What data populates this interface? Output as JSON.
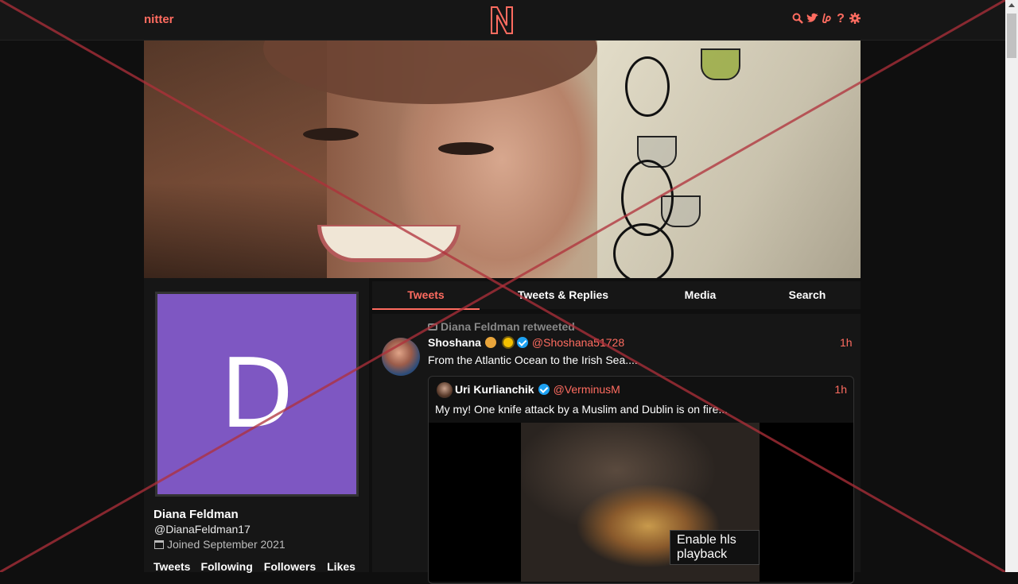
{
  "navbar": {
    "brand": "nitter",
    "logo_letter": "N",
    "icons": [
      "search-icon",
      "twitter-icon",
      "liberapay-icon",
      "help-icon",
      "gear-icon"
    ]
  },
  "profile": {
    "avatar_letter": "D",
    "fullname": "Diana Feldman",
    "username": "@DianaFeldman17",
    "joined": "Joined September 2021",
    "stats": [
      "Tweets",
      "Following",
      "Followers",
      "Likes"
    ]
  },
  "tabs": [
    {
      "label": "Tweets",
      "active": true
    },
    {
      "label": "Tweets & Replies",
      "active": false
    },
    {
      "label": "Media",
      "active": false
    },
    {
      "label": "Search",
      "active": false
    }
  ],
  "tweet": {
    "retweet_header": "Diana Feldman retweeted",
    "fullname": "Shoshana",
    "handle": "@Shoshana51728",
    "date": "1h",
    "text": "From the Atlantic Ocean  to the Irish Sea....",
    "quote": {
      "fullname": "Uri Kurlianchik",
      "handle": "@VerminusM",
      "date": "1h",
      "text": "My my! One knife attack by a Muslim and Dublin is on fire...",
      "media_button": "Enable hls playback"
    }
  },
  "colors": {
    "accent": "#ff6c60",
    "background": "#0f0f0f",
    "card": "#161616",
    "avatar_bg": "#7e57c2"
  }
}
